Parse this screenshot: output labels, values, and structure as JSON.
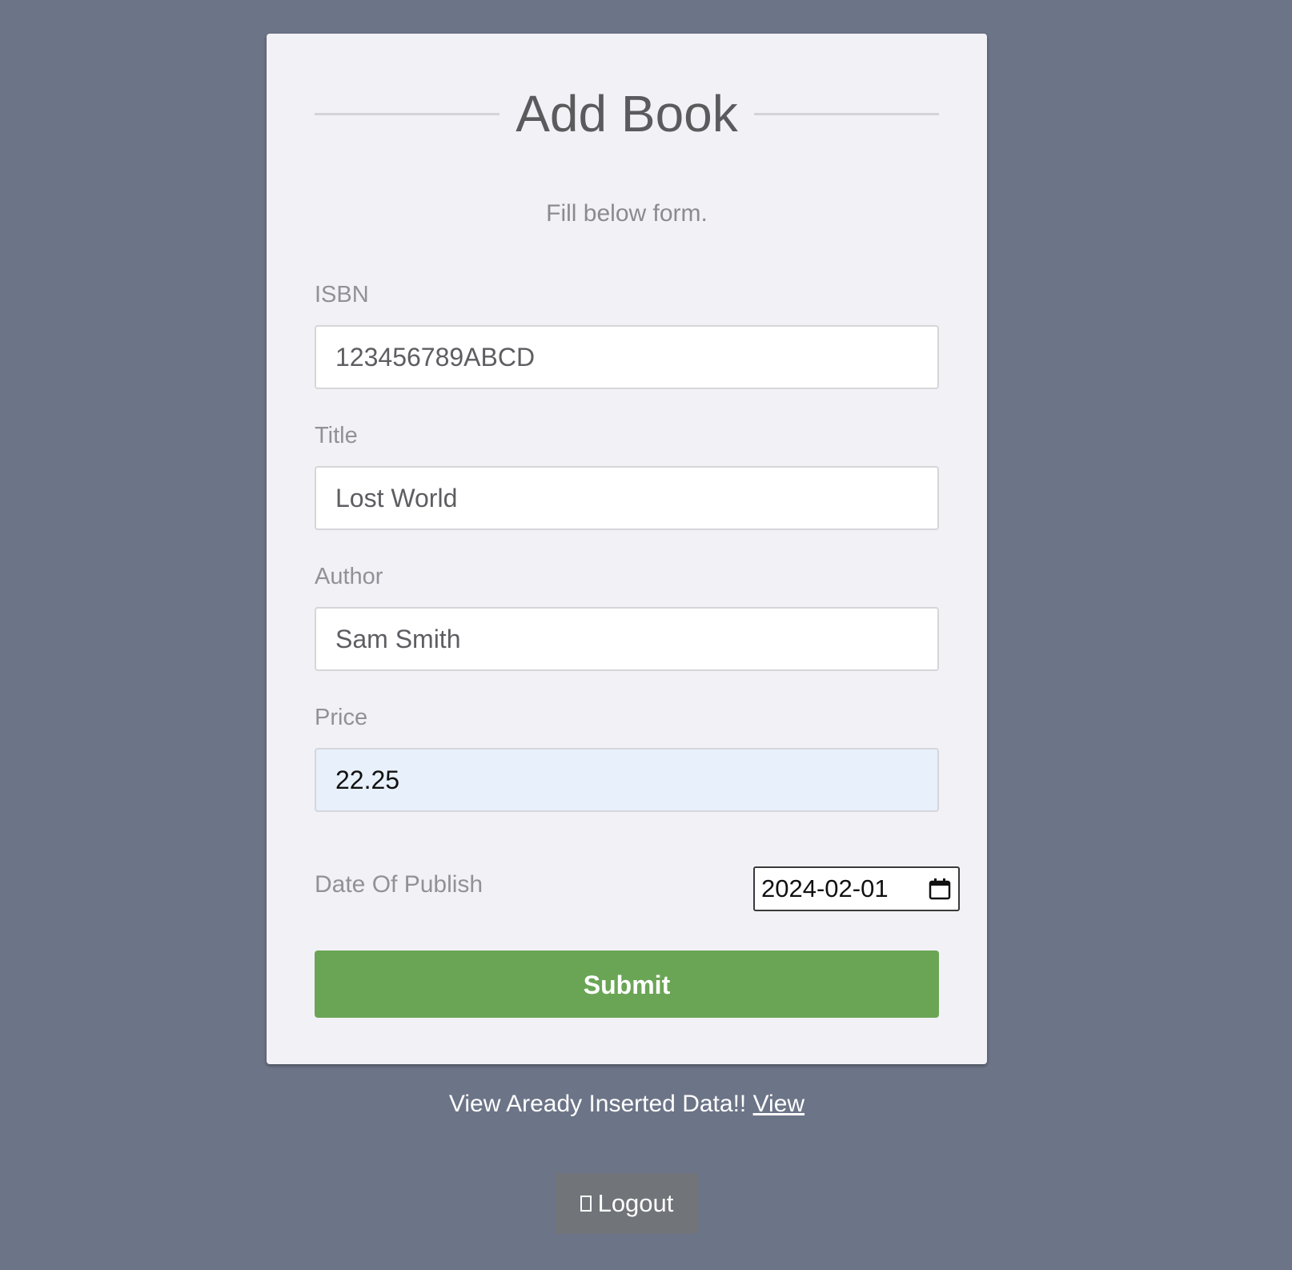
{
  "form": {
    "title": "Add Book",
    "subtitle": "Fill below form.",
    "fields": [
      {
        "label": "ISBN",
        "value": "123456789ABCD"
      },
      {
        "label": "Title",
        "value": "Lost World"
      },
      {
        "label": "Author",
        "value": "Sam Smith"
      },
      {
        "label": "Price",
        "value": "22.25"
      }
    ],
    "date": {
      "label": "Date Of Publish",
      "value": "2024-02-01"
    },
    "submit_label": "Submit"
  },
  "footer": {
    "text": "View Aready Inserted Data!!",
    "link_label": "View"
  },
  "logout": {
    "label": "Logout",
    "icon": "logout-icon"
  },
  "colors": {
    "background": "#6c7487",
    "card": "#f2f1f6",
    "submit": "#6aa555",
    "logout": "#717479",
    "autofill": "#e8f0fb"
  }
}
